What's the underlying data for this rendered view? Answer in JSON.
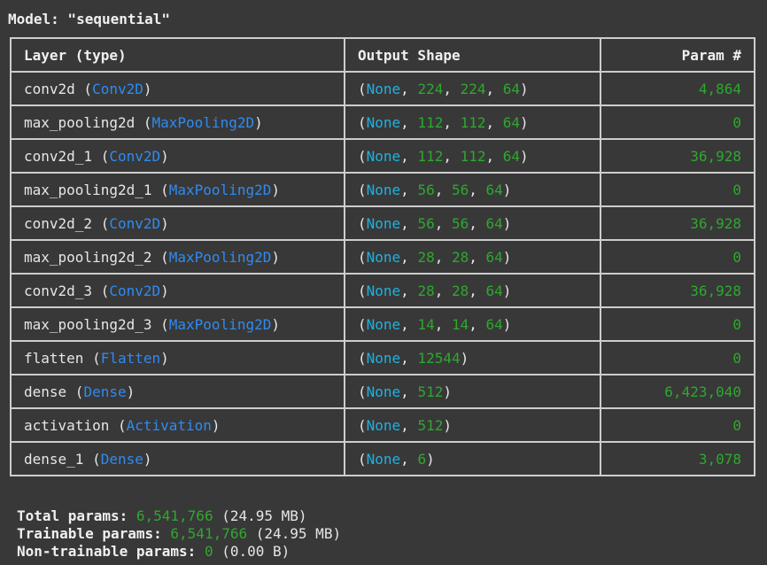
{
  "model_title": "Model: \"sequential\"",
  "headers": {
    "layer": "Layer (type)",
    "output_shape": "Output Shape",
    "params": "Param #"
  },
  "layers": [
    {
      "name": "conv2d",
      "type": "Conv2D",
      "shape": [
        "224",
        "224",
        "64"
      ],
      "params": "4,864"
    },
    {
      "name": "max_pooling2d",
      "type": "MaxPooling2D",
      "shape": [
        "112",
        "112",
        "64"
      ],
      "params": "0"
    },
    {
      "name": "conv2d_1",
      "type": "Conv2D",
      "shape": [
        "112",
        "112",
        "64"
      ],
      "params": "36,928"
    },
    {
      "name": "max_pooling2d_1",
      "type": "MaxPooling2D",
      "shape": [
        "56",
        "56",
        "64"
      ],
      "params": "0"
    },
    {
      "name": "conv2d_2",
      "type": "Conv2D",
      "shape": [
        "56",
        "56",
        "64"
      ],
      "params": "36,928"
    },
    {
      "name": "max_pooling2d_2",
      "type": "MaxPooling2D",
      "shape": [
        "28",
        "28",
        "64"
      ],
      "params": "0"
    },
    {
      "name": "conv2d_3",
      "type": "Conv2D",
      "shape": [
        "28",
        "28",
        "64"
      ],
      "params": "36,928"
    },
    {
      "name": "max_pooling2d_3",
      "type": "MaxPooling2D",
      "shape": [
        "14",
        "14",
        "64"
      ],
      "params": "0"
    },
    {
      "name": "flatten",
      "type": "Flatten",
      "shape": [
        "12544"
      ],
      "params": "0"
    },
    {
      "name": "dense",
      "type": "Dense",
      "shape": [
        "512"
      ],
      "params": "6,423,040"
    },
    {
      "name": "activation",
      "type": "Activation",
      "shape": [
        "512"
      ],
      "params": "0"
    },
    {
      "name": "dense_1",
      "type": "Dense",
      "shape": [
        "6"
      ],
      "params": "3,078"
    }
  ],
  "none_label": "None",
  "footer": {
    "total_label": "Total params:",
    "total_value": "6,541,766",
    "total_size": "(24.95 MB)",
    "trainable_label": "Trainable params:",
    "trainable_value": "6,541,766",
    "trainable_size": "(24.95 MB)",
    "nontrainable_label": "Non-trainable params:",
    "nontrainable_value": "0",
    "nontrainable_size": "(0.00 B)"
  },
  "colors": {
    "background": "#383838",
    "type_blue": "#2f8bf1",
    "none_cyan": "#1fb2e0",
    "number_green": "#2ea82e",
    "border": "#cdcdcd"
  }
}
